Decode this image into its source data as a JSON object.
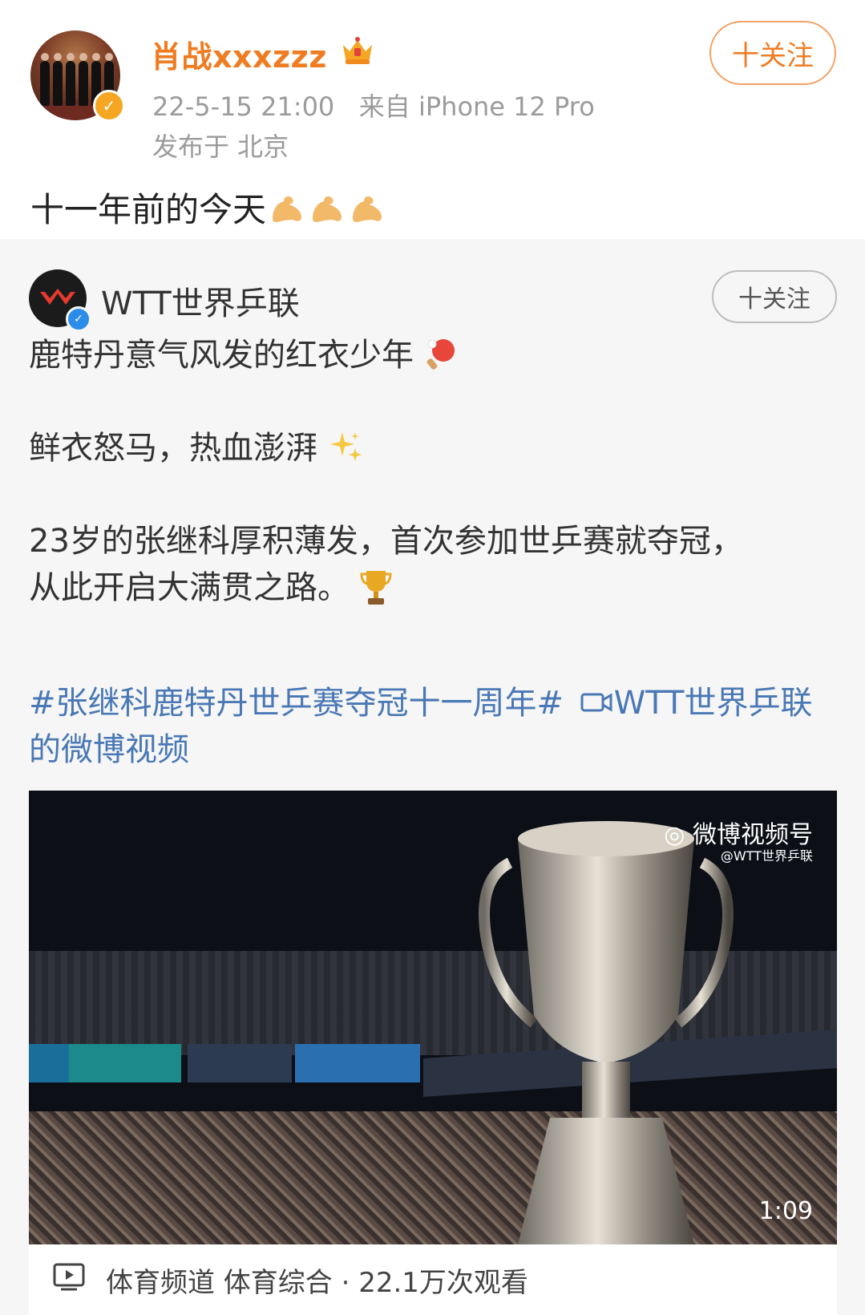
{
  "post": {
    "username": "肖战xxxzzz",
    "time": "22-5-15 21:00",
    "source": "来自 iPhone 12 Pro",
    "location": "发布于 北京",
    "follow_label": "十关注",
    "text": "十一年前的今天"
  },
  "repost": {
    "author": "WTT世界乒联",
    "follow_label": "十关注",
    "para1": "鹿特丹意气风发的红衣少年",
    "para2": "鲜衣怒马，热血澎湃",
    "para3_line1": "23岁的张继科厚积薄发，首次参加世乒赛就夺冠，",
    "para3_line2": "从此开启大满贯之路。",
    "hashtag": "#张继科鹿特丹世乒赛夺冠十一周年#",
    "video_link": "WTT世界乒联的微博视频",
    "video": {
      "watermark": "微博视频号",
      "watermark_sub": "@WTT世界乒联",
      "duration": "1:09",
      "meta": "体育频道 体育综合 · 22.1万次观看"
    }
  },
  "colors": {
    "username": "#f07c22",
    "link": "#4a78b5",
    "verified_gold": "#f5a623",
    "verified_blue": "#2b8cea"
  }
}
